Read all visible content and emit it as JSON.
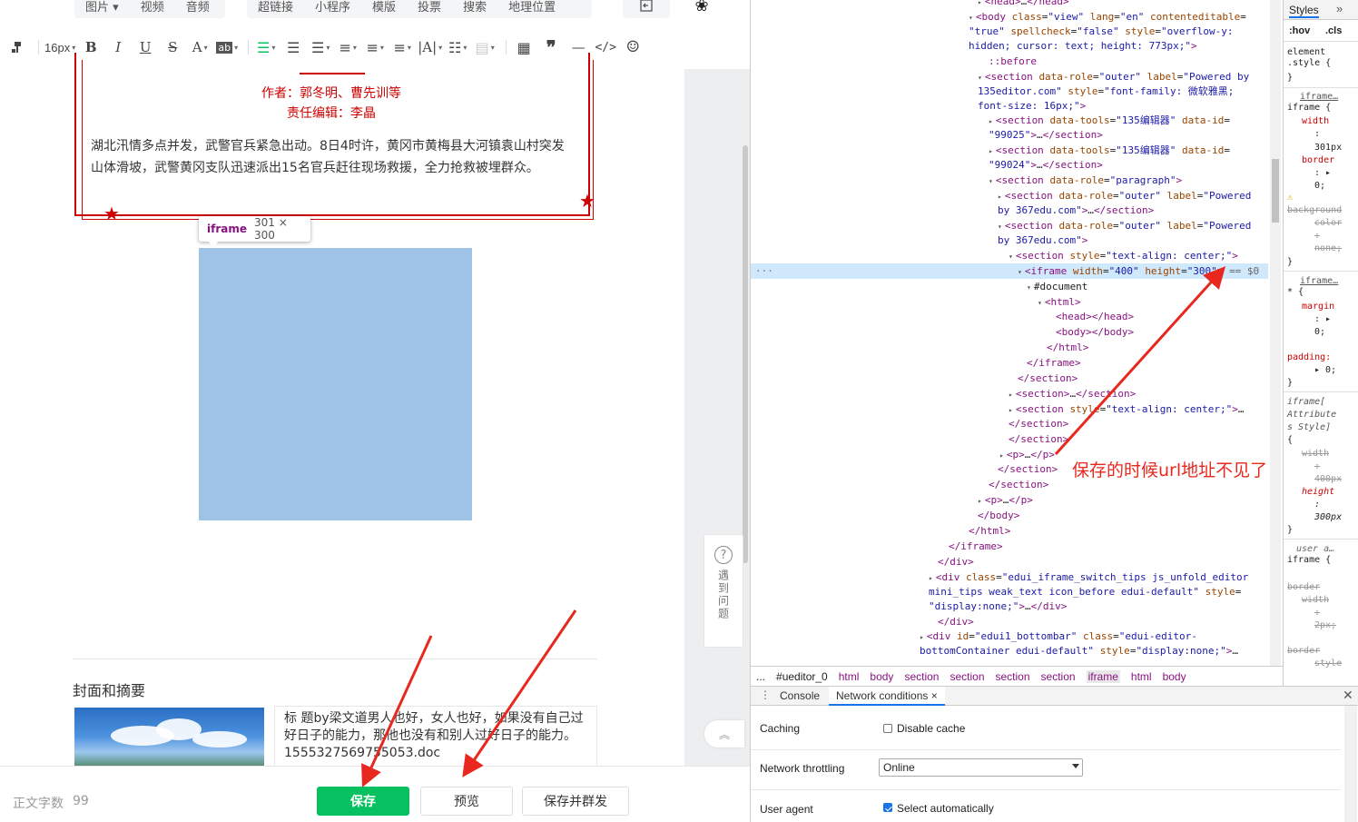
{
  "editor": {
    "top_tabs": [
      "图片",
      "视频",
      "音频",
      "超链接",
      "小程序",
      "模版",
      "投票",
      "搜索",
      "地理位置"
    ],
    "font_size": "16px",
    "article": {
      "author_line": "作者：郭冬明、曹先训等",
      "editor_line": "责任编辑：李晶",
      "body": "湖北汛情多点并发，武警官兵紧急出动。8日4时许，黄冈市黄梅县大河镇袁山村突发山体滑坡，武警黄冈支队迅速派出15名官兵赶往现场救援，全力抢救被埋群众。"
    },
    "iframe_tooltip": {
      "tag": "iframe",
      "dims": "301 × 300"
    },
    "help_text": "遇到问题",
    "cover_title": "封面和摘要",
    "summary_text": "标 题by梁文道男人也好，女人也好，如果没有自己过好日子的能力，那他也没有和别人过好日子的能力。1555327569755053.doc",
    "word_count_label": "正文字数",
    "word_count": "99",
    "buttons": {
      "save": "保存",
      "preview": "预览",
      "save_send": "保存并群发"
    }
  },
  "devtools": {
    "breadcrumb": [
      "...",
      "#ueditor_0",
      "html",
      "body",
      "section",
      "section",
      "section",
      "section",
      "iframe",
      "html",
      "body"
    ],
    "selected_crumb_index": 8,
    "styles": {
      "tab_label": "Styles",
      "more": "»",
      "filter_hov": ":hov",
      "filter_cls": ".cls"
    },
    "drawer": {
      "tabs": [
        "Console",
        "Network conditions"
      ],
      "caching_label": "Caching",
      "disable_cache_label": "Disable cache",
      "throttling_label": "Network throttling",
      "throttling_value": "Online",
      "user_agent_label": "User agent",
      "select_auto_label": "Select automatically"
    }
  },
  "annotation": {
    "text": "保存的时候url地址不见了",
    "color": "#e8281e"
  },
  "colors": {
    "accent_green": "#07c160",
    "article_red": "#cc0000",
    "iframe_fill": "#9fc2e7",
    "devtools_selected_row": "#cfe8fc"
  }
}
